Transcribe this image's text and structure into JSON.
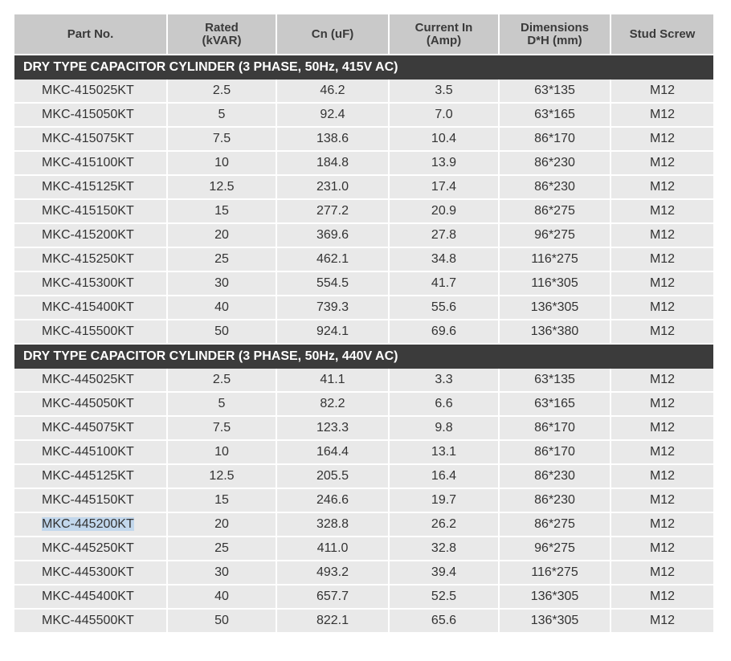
{
  "headers": [
    "Part No.",
    "Rated\n(kVAR)",
    "Cn (uF)",
    "Current In\n(Amp)",
    "Dimensions\nD*H (mm)",
    "Stud Screw"
  ],
  "sections": [
    {
      "title": "DRY TYPE CAPACITOR CYLINDER (3 PHASE, 50Hz, 415V AC)",
      "rows": [
        [
          "MKC-415025KT",
          "2.5",
          "46.2",
          "3.5",
          "63*135",
          "M12"
        ],
        [
          "MKC-415050KT",
          "5",
          "92.4",
          "7.0",
          "63*165",
          "M12"
        ],
        [
          "MKC-415075KT",
          "7.5",
          "138.6",
          "10.4",
          "86*170",
          "M12"
        ],
        [
          "MKC-415100KT",
          "10",
          "184.8",
          "13.9",
          "86*230",
          "M12"
        ],
        [
          "MKC-415125KT",
          "12.5",
          "231.0",
          "17.4",
          "86*230",
          "M12"
        ],
        [
          "MKC-415150KT",
          "15",
          "277.2",
          "20.9",
          "86*275",
          "M12"
        ],
        [
          "MKC-415200KT",
          "20",
          "369.6",
          "27.8",
          "96*275",
          "M12"
        ],
        [
          "MKC-415250KT",
          "25",
          "462.1",
          "34.8",
          "116*275",
          "M12"
        ],
        [
          "MKC-415300KT",
          "30",
          "554.5",
          "41.7",
          "116*305",
          "M12"
        ],
        [
          "MKC-415400KT",
          "40",
          "739.3",
          "55.6",
          "136*305",
          "M12"
        ],
        [
          "MKC-415500KT",
          "50",
          "924.1",
          "69.6",
          "136*380",
          "M12"
        ]
      ]
    },
    {
      "title": "DRY TYPE CAPACITOR CYLINDER (3 PHASE, 50Hz, 440V AC)",
      "rows": [
        [
          "MKC-445025KT",
          "2.5",
          "41.1",
          "3.3",
          "63*135",
          "M12"
        ],
        [
          "MKC-445050KT",
          "5",
          "82.2",
          "6.6",
          "63*165",
          "M12"
        ],
        [
          "MKC-445075KT",
          "7.5",
          "123.3",
          "9.8",
          "86*170",
          "M12"
        ],
        [
          "MKC-445100KT",
          "10",
          "164.4",
          "13.1",
          "86*170",
          "M12"
        ],
        [
          "MKC-445125KT",
          "12.5",
          "205.5",
          "16.4",
          "86*230",
          "M12"
        ],
        [
          "MKC-445150KT",
          "15",
          "246.6",
          "19.7",
          "86*230",
          "M12"
        ],
        [
          "MKC-445200KT",
          "20",
          "328.8",
          "26.2",
          "86*275",
          "M12"
        ],
        [
          "MKC-445250KT",
          "25",
          "411.0",
          "32.8",
          "96*275",
          "M12"
        ],
        [
          "MKC-445300KT",
          "30",
          "493.2",
          "39.4",
          "116*275",
          "M12"
        ],
        [
          "MKC-445400KT",
          "40",
          "657.7",
          "52.5",
          "136*305",
          "M12"
        ],
        [
          "MKC-445500KT",
          "50",
          "822.1",
          "65.6",
          "136*305",
          "M12"
        ]
      ]
    }
  ],
  "selected_text": "MKC-445200KT",
  "colors": {
    "header_bg": "#c9c9c9",
    "section_bg": "#3b3b3b",
    "row_bg": "#e9e9e9",
    "selection": "#c2d7ec"
  }
}
